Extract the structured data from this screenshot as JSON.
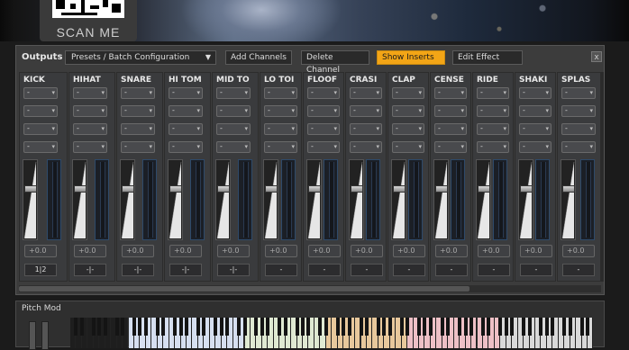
{
  "banner": {
    "scan_text": "SCAN ME"
  },
  "header": {
    "outputs_label": "Outputs",
    "preset_selector": "Presets / Batch Configuration",
    "buttons": [
      {
        "label": "Add Channels",
        "active": false
      },
      {
        "label": "Delete Channel",
        "active": false
      },
      {
        "label": "Show Inserts",
        "active": true
      },
      {
        "label": "Edit Effect",
        "active": false
      }
    ],
    "close_label": "x"
  },
  "channels": [
    {
      "name": "KICK",
      "route": "1|2",
      "gain": "+0.0"
    },
    {
      "name": "HIHAT",
      "route": "-|-",
      "gain": "+0.0"
    },
    {
      "name": "SNARE",
      "route": "-|-",
      "gain": "+0.0"
    },
    {
      "name": "HI TOM",
      "route": "-|-",
      "gain": "+0.0"
    },
    {
      "name": "MID TO",
      "route": "-|-",
      "gain": "+0.0"
    },
    {
      "name": "LO TOI",
      "route": "-",
      "gain": "+0.0"
    },
    {
      "name": "FLOOF",
      "route": "-",
      "gain": "+0.0"
    },
    {
      "name": "CRASI",
      "route": "-",
      "gain": "+0.0"
    },
    {
      "name": "CLAP",
      "route": "-",
      "gain": "+0.0"
    },
    {
      "name": "CENSE",
      "route": "-",
      "gain": "+0.0"
    },
    {
      "name": "RIDE",
      "route": "-",
      "gain": "+0.0"
    },
    {
      "name": "SHAKI",
      "route": "-",
      "gain": "+0.0"
    },
    {
      "name": "SPLAS",
      "route": "-",
      "gain": "+0.0"
    }
  ],
  "insert_slot_label": "-",
  "keyboard": {
    "pitch_mod_label": "Pitch Mod",
    "zone_colors": [
      "#d6dff0",
      "#dfe9d2",
      "#e8c89c",
      "#eec0c6",
      "#d9d9d9"
    ]
  }
}
